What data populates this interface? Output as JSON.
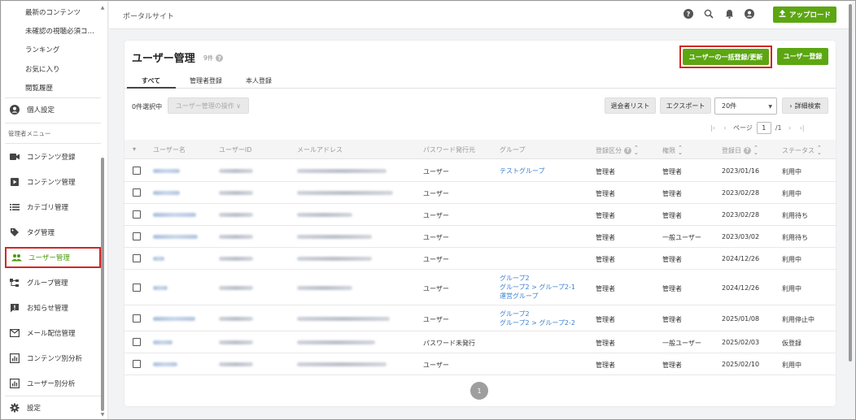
{
  "app": {
    "site_title": "ポータルサイト",
    "upload_label": "アップロード"
  },
  "sidebar": {
    "sub_items": [
      "最新のコンテンツ",
      "未確認の視聴必須コン…",
      "ランキング",
      "お気に入り",
      "閲覧履歴"
    ],
    "personal": "個人設定",
    "admin_section": "管理者メニュー",
    "admin_items": [
      {
        "label": "コンテンツ登録",
        "icon": "video-icon"
      },
      {
        "label": "コンテンツ管理",
        "icon": "play-square-icon"
      },
      {
        "label": "カテゴリ管理",
        "icon": "list-icon"
      },
      {
        "label": "タグ管理",
        "icon": "tag-icon"
      },
      {
        "label": "ユーザー管理",
        "icon": "users-icon",
        "active": true
      },
      {
        "label": "グループ管理",
        "icon": "tree-icon"
      },
      {
        "label": "お知らせ管理",
        "icon": "notice-icon"
      },
      {
        "label": "メール配信管理",
        "icon": "mail-icon"
      },
      {
        "label": "コンテンツ別分析",
        "icon": "chart-icon"
      },
      {
        "label": "ユーザー別分析",
        "icon": "chart-icon"
      }
    ],
    "settings": "設定"
  },
  "page": {
    "title": "ユーザー管理",
    "count": "9件",
    "bulk_button": "ユーザーの一括登録/更新",
    "register_button": "ユーザー登録",
    "tabs": [
      "すべて",
      "管理者登録",
      "本人登録"
    ],
    "selected": "0件選択中",
    "ops_label": "ユーザー管理の操作 ∨",
    "withdrawn_list": "退会者リスト",
    "export": "エクスポート",
    "per_page": "20件",
    "detail_search": "詳細検索",
    "pager": {
      "label": "ページ",
      "current": "1",
      "total": "/1"
    },
    "page_button": "1"
  },
  "colors": {
    "accent": "#5ca612",
    "highlight": "#d32626",
    "link": "#3a7fd0"
  },
  "table": {
    "headers": [
      "ユーザー名",
      "ユーザーID",
      "メールアドレス",
      "パスワード発行元",
      "グループ",
      "登録区分",
      "権限",
      "登録日",
      "ステータス"
    ],
    "rows": [
      {
        "issuer": "ユーザー",
        "groups": [
          "テストグループ"
        ],
        "kind": "管理者",
        "role": "管理者",
        "date": "2023/01/16",
        "status": "利用中"
      },
      {
        "issuer": "ユーザー",
        "groups": [],
        "kind": "管理者",
        "role": "管理者",
        "date": "2023/02/28",
        "status": "利用中"
      },
      {
        "issuer": "ユーザー",
        "groups": [],
        "kind": "管理者",
        "role": "管理者",
        "date": "2023/02/28",
        "status": "利用待ち"
      },
      {
        "issuer": "ユーザー",
        "groups": [],
        "kind": "管理者",
        "role": "一般ユーザー",
        "date": "2023/03/02",
        "status": "利用待ち"
      },
      {
        "issuer": "ユーザー",
        "groups": [],
        "kind": "管理者",
        "role": "管理者",
        "date": "2024/12/26",
        "status": "利用中"
      },
      {
        "issuer": "ユーザー",
        "groups": [
          "グループ2",
          "グループ2 > グループ2-1",
          "運営グループ"
        ],
        "kind": "管理者",
        "role": "管理者",
        "date": "2024/12/26",
        "status": "利用中"
      },
      {
        "issuer": "ユーザー",
        "groups": [
          "グループ2",
          "グループ2 > グループ2-2"
        ],
        "kind": "管理者",
        "role": "管理者",
        "date": "2025/01/08",
        "status": "利用停止中"
      },
      {
        "issuer": "パスワード未発行",
        "groups": [],
        "kind": "管理者",
        "role": "一般ユーザー",
        "date": "2025/02/03",
        "status": "仮登録"
      },
      {
        "issuer": "ユーザー",
        "groups": [],
        "kind": "管理者",
        "role": "管理者",
        "date": "2025/02/10",
        "status": "利用中"
      }
    ]
  }
}
